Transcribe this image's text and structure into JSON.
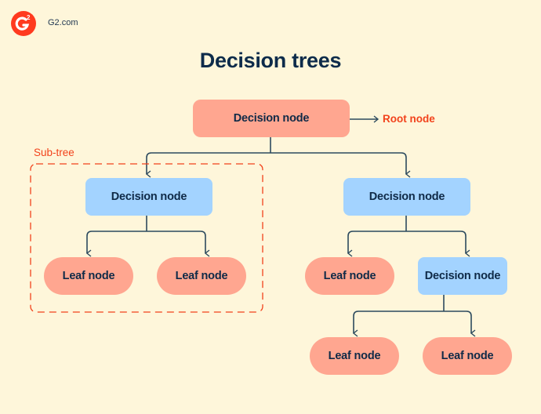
{
  "brand": {
    "name": "G2.com",
    "logo_icon": "g2-logo-icon",
    "accent": "#ff3a1f"
  },
  "title": "Decision trees",
  "annotations": {
    "root": "Root node",
    "subtree": "Sub-tree"
  },
  "colors": {
    "background": "#fef6da",
    "decision_root": "#ffa690",
    "decision_node": "#a3d3ff",
    "leaf_node": "#ffa690",
    "connector": "#2c4a5e",
    "annotation": "#f2421b"
  },
  "nodes": {
    "root": "Decision node",
    "left_decision": "Decision node",
    "right_decision": "Decision node",
    "right_right_decision": "Decision node",
    "left_leaf_1": "Leaf node",
    "left_leaf_2": "Leaf node",
    "right_leaf_1": "Leaf node",
    "bottom_leaf_1": "Leaf node",
    "bottom_leaf_2": "Leaf node"
  }
}
